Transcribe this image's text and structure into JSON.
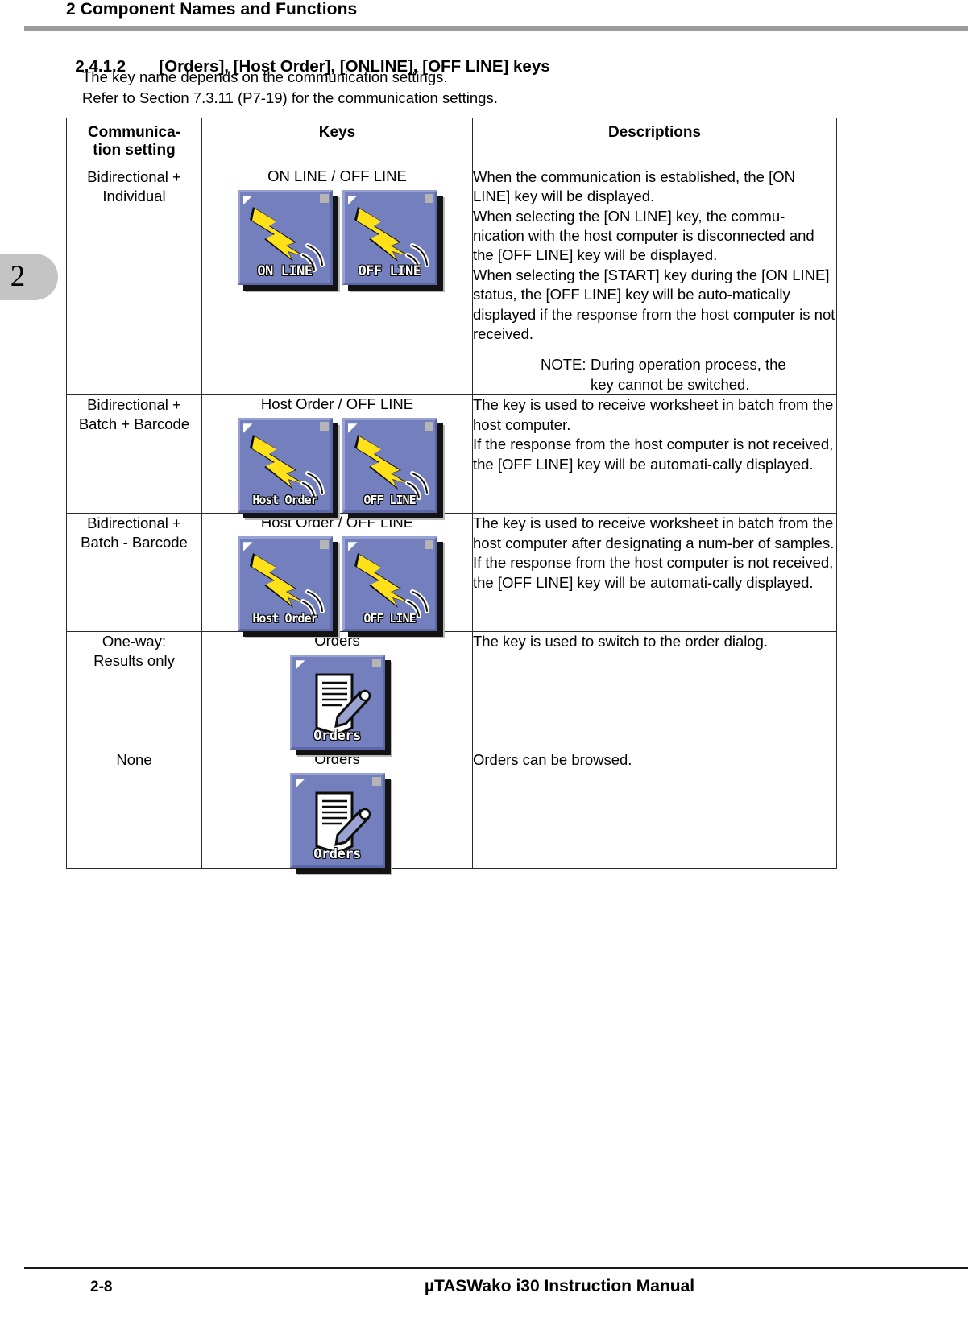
{
  "header": {
    "running_head": "2 Component Names and Functions"
  },
  "section": {
    "number": "2.4.1.2",
    "title": "[Orders], [Host Order], [ONLINE], [OFF LINE] keys",
    "intro_line_1": "The key name depends on the communication settings.",
    "intro_line_2": "Refer to Section 7.3.11 (P7-19) for the communication settings."
  },
  "side_tab": {
    "chapter": "2"
  },
  "table": {
    "headers": {
      "setting": "Communica-\ntion setting",
      "setting_line1": "Communica-",
      "setting_line2": "tion setting",
      "keys": "Keys",
      "descriptions": "Descriptions"
    },
    "rows": [
      {
        "setting_line1": "Bidirectional +",
        "setting_line2": "Individual",
        "keys_label": "ON LINE / OFF LINE",
        "buttons": [
          {
            "icon": "lightning-signal-icon",
            "caption": "ON LINE"
          },
          {
            "icon": "lightning-signal-icon",
            "caption": "OFF LINE"
          }
        ],
        "description_paragraphs": [
          "When the communication is established, the [ON LINE] key will be displayed.",
          "When selecting the [ON LINE] key, the commu-nication with the host computer is disconnected and the [OFF LINE] key will be displayed.",
          "When selecting the [START] key during the [ON LINE] status, the [OFF LINE] key will be auto-matically displayed if the response from the host computer is not received."
        ],
        "note": {
          "label": "NOTE:",
          "line1": "During operation process, the",
          "line2": "key cannot be switched."
        }
      },
      {
        "setting_line1": "Bidirectional +",
        "setting_line2": "Batch + Barcode",
        "keys_label": "Host Order / OFF LINE",
        "buttons": [
          {
            "icon": "lightning-signal-icon",
            "caption": "Host Order"
          },
          {
            "icon": "lightning-signal-icon",
            "caption": "OFF LINE"
          }
        ],
        "description_paragraphs": [
          "The key is used to receive worksheet in batch from the host computer.",
          "If the response from the host computer is not received, the [OFF LINE] key will be automati-cally displayed."
        ]
      },
      {
        "setting_line1": "Bidirectional +",
        "setting_line2": "Batch - Barcode",
        "keys_label": "Host Order / OFF LINE",
        "buttons": [
          {
            "icon": "lightning-signal-icon",
            "caption": "Host Order"
          },
          {
            "icon": "lightning-signal-icon",
            "caption": "OFF LINE"
          }
        ],
        "description_paragraphs": [
          "The key is used to receive worksheet in batch from the host computer after designating a num-ber of samples.",
          "If the response from the host computer is not received, the [OFF LINE] key will be automati-cally displayed."
        ]
      },
      {
        "setting_line1": "One-way:",
        "setting_line2": "Results only",
        "keys_label": "Orders",
        "buttons": [
          {
            "icon": "document-pencil-icon",
            "caption": "Orders"
          }
        ],
        "description_paragraphs": [
          "The key is used to switch to the order dialog."
        ]
      },
      {
        "setting_line1": "None",
        "setting_line2": "",
        "keys_label": "Orders",
        "buttons": [
          {
            "icon": "document-pencil-icon",
            "caption": "Orders"
          }
        ],
        "description_paragraphs": [
          "Orders can be browsed."
        ]
      }
    ]
  },
  "footer": {
    "page_number": "2-8",
    "manual_title": "µTASWako i30  Instruction Manual"
  },
  "colors": {
    "rule_gray": "#9c9c9c",
    "tab_gray": "#c4c4c4",
    "button_face": "#7480bd",
    "button_light": "#98a2d2",
    "button_dark": "#5b67a6",
    "lightning_yellow": "#ffe11a",
    "text": "#000000"
  }
}
